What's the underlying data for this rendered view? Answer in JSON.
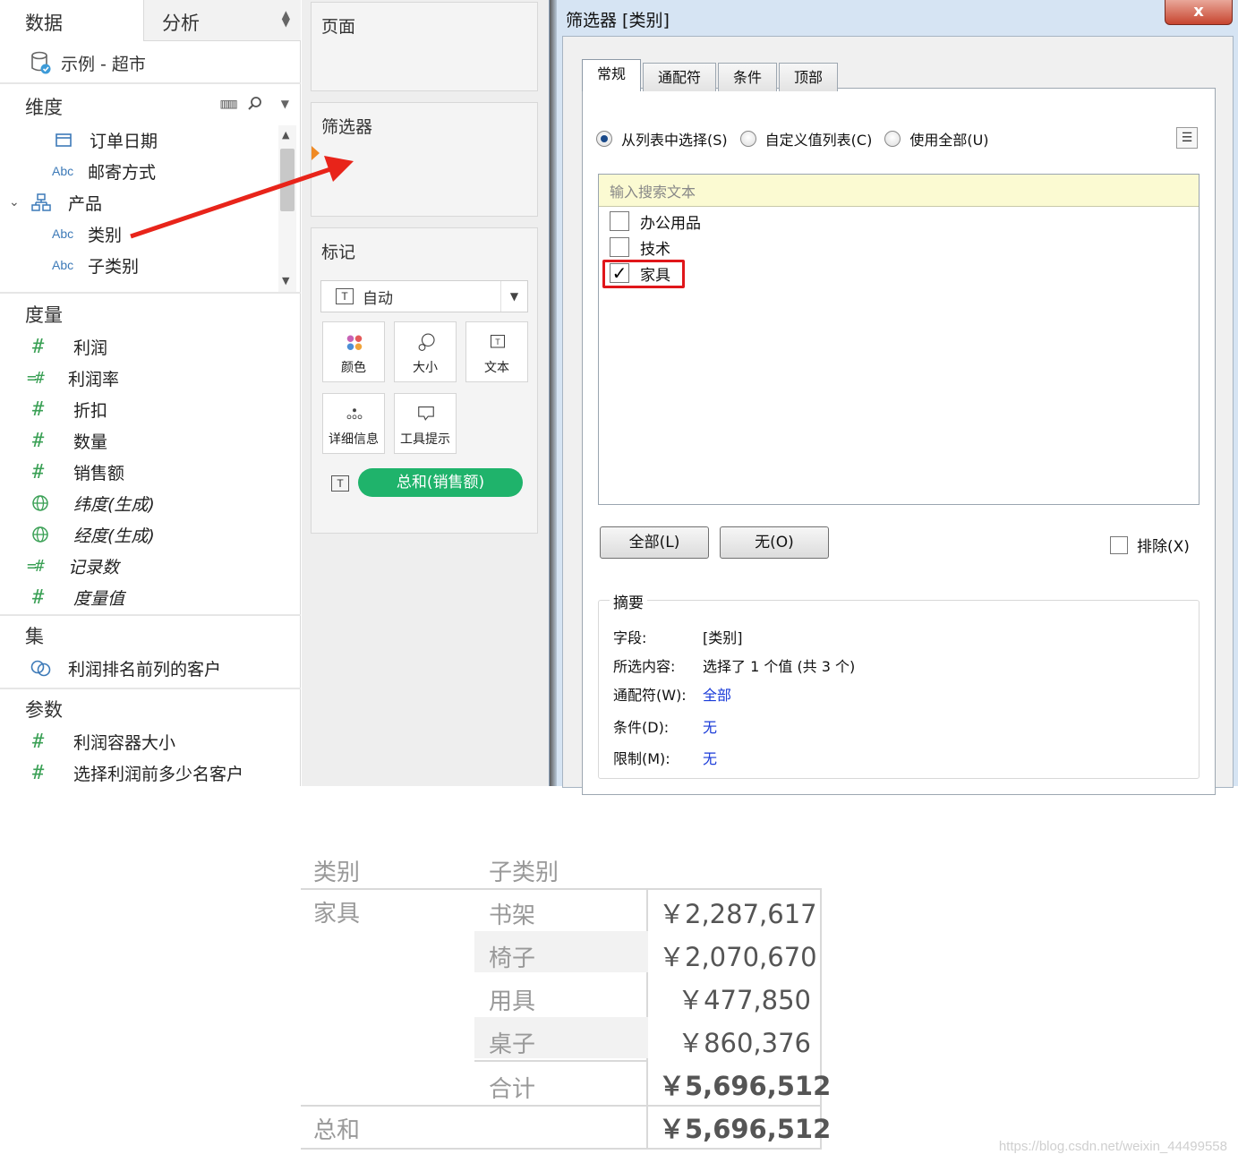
{
  "data_pane": {
    "tab_data": "数据",
    "tab_analysis": "分析",
    "datasource": "示例 - 超市",
    "dimensions_title": "维度",
    "dimensions": [
      {
        "type": "date",
        "label": "订单日期"
      },
      {
        "type": "Abc",
        "label": "邮寄方式"
      },
      {
        "type": "hierarchy",
        "label": "产品"
      },
      {
        "type": "Abc",
        "label": "类别"
      },
      {
        "type": "Abc",
        "label": "子类别"
      }
    ],
    "measures_title": "度量",
    "measures": [
      {
        "type": "#",
        "label": "利润"
      },
      {
        "type": "=#",
        "label": "利润率"
      },
      {
        "type": "#",
        "label": "折扣"
      },
      {
        "type": "#",
        "label": "数量"
      },
      {
        "type": "#",
        "label": "销售额"
      },
      {
        "type": "globe",
        "label": "纬度(生成)"
      },
      {
        "type": "globe",
        "label": "经度(生成)"
      },
      {
        "type": "=#",
        "label": "记录数"
      },
      {
        "type": "#",
        "label": "度量值"
      }
    ],
    "sets_title": "集",
    "sets": [
      {
        "label": "利润排名前列的客户"
      }
    ],
    "params_title": "参数",
    "params": [
      {
        "label": "利润容器大小"
      },
      {
        "label": "选择利润前多少名客户"
      }
    ]
  },
  "shelves": {
    "pages_title": "页面",
    "filters_title": "筛选器",
    "marks_title": "标记",
    "marks_type": "自动",
    "mark_buttons": [
      "颜色",
      "大小",
      "文本",
      "详细信息",
      "工具提示"
    ],
    "pill": "总和(销售额)"
  },
  "dialog": {
    "title": "筛选器 [类别]",
    "close": "x",
    "tabs": [
      "常规",
      "通配符",
      "条件",
      "顶部"
    ],
    "radios": [
      "从列表中选择(S)",
      "自定义值列表(C)",
      "使用全部(U)"
    ],
    "search_placeholder": "输入搜索文本",
    "items": [
      {
        "label": "办公用品",
        "checked": false
      },
      {
        "label": "技术",
        "checked": false
      },
      {
        "label": "家具",
        "checked": true
      }
    ],
    "btn_all": "全部(L)",
    "btn_none": "无(O)",
    "exclude": "排除(X)",
    "summary_title": "摘要",
    "summary": [
      {
        "key": "字段:",
        "value": "[类别]"
      },
      {
        "key": "所选内容:",
        "value": "选择了 1 个值 (共 3 个)"
      },
      {
        "key": "通配符(W):",
        "value": "全部"
      },
      {
        "key": "条件(D):",
        "value": "无"
      },
      {
        "key": "限制(M):",
        "value": "无"
      }
    ]
  },
  "crosstab": {
    "headers": [
      "类别",
      "子类别"
    ],
    "category": "家具",
    "rows": [
      {
        "sub": "书架",
        "value": "￥2,287,617"
      },
      {
        "sub": "椅子",
        "value": "￥2,070,670"
      },
      {
        "sub": "用具",
        "value": "￥477,850"
      },
      {
        "sub": "桌子",
        "value": "￥860,376"
      },
      {
        "sub": "合计",
        "value": "￥5,696,512"
      }
    ],
    "grand_label": "总和",
    "grand_value": "￥5,696,512"
  },
  "watermark": "https://blog.csdn.net/weixin_44499558",
  "colors": {
    "pill": "#1fb36b",
    "highlight": "#e0161a",
    "measure_green": "#3aa055",
    "dimension_blue": "#3d7ab8"
  }
}
